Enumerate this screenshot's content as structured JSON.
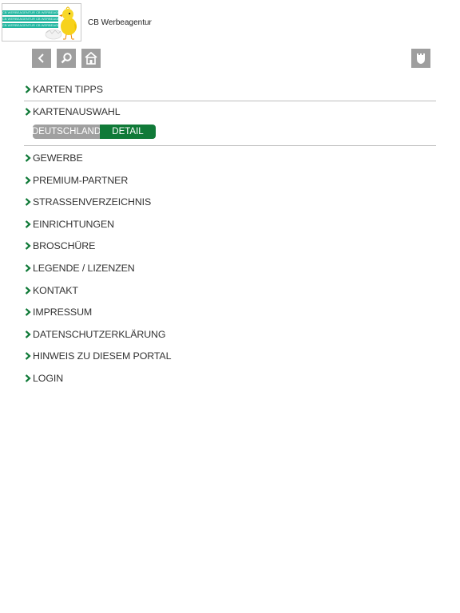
{
  "header": {
    "company_name": "CB Werbeagentur",
    "logo_lines": [
      "CB WERBEAGENTUR CB WERBEAGENTUR",
      "CB WERBEAGENTUR CB WERBEAGENTUR",
      "CB WERBEAGENTUR CB WERBEAGENTUR"
    ]
  },
  "toolbar": {
    "icons": [
      "back-icon",
      "search-icon",
      "home-icon",
      "shield-icon"
    ],
    "color": "#9e9e9e"
  },
  "menu": {
    "accent": "#107a38",
    "karten_tipps": "KARTEN TIPPS",
    "kartenauswahl": "KARTENAUSWAHL",
    "map_options": {
      "deutschland": "DEUTSCHLAND",
      "detail": "DETAIL",
      "selected": "DETAIL"
    },
    "items": [
      "GEWERBE",
      "PREMIUM-PARTNER",
      "STRASSENVERZEICHNIS",
      "EINRICHTUNGEN",
      "BROSCHÜRE",
      "LEGENDE / LIZENZEN",
      "KONTAKT",
      "IMPRESSUM",
      "DATENSCHUTZERKLÄRUNG",
      "HINWEIS ZU DIESEM PORTAL",
      "LOGIN"
    ]
  }
}
